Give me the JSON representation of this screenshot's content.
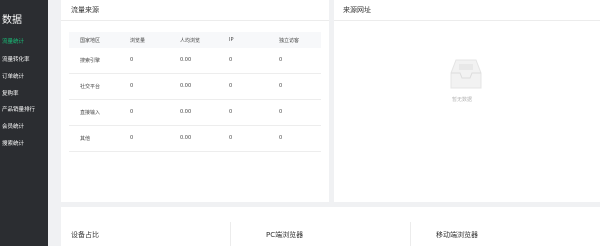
{
  "sidebar": {
    "title": "数据",
    "items": [
      {
        "label": "流量统计",
        "active": true
      },
      {
        "label": "流量转化率",
        "active": false
      },
      {
        "label": "订单统计",
        "active": false
      },
      {
        "label": "复购率",
        "active": false
      },
      {
        "label": "产品销量排行",
        "active": false
      },
      {
        "label": "会员统计",
        "active": false
      },
      {
        "label": "搜索统计",
        "active": false
      }
    ],
    "active_color": "#18c27a"
  },
  "traffic_source": {
    "title": "流量来源",
    "columns": [
      "国家地区",
      "浏览量",
      "人均浏览",
      "IP",
      "独立访客"
    ],
    "rows": [
      [
        "搜索引擎",
        "0",
        "0.00",
        "0",
        "0"
      ],
      [
        "社交平台",
        "0",
        "0.00",
        "0",
        "0"
      ],
      [
        "直接输入",
        "0",
        "0.00",
        "0",
        "0"
      ],
      [
        "其他",
        "0",
        "0.00",
        "0",
        "0"
      ]
    ]
  },
  "source_url": {
    "title": "来源网址",
    "empty_text": "暂无数据",
    "empty_icon": "inbox-icon"
  },
  "bottom": {
    "device_title": "设备占比",
    "pc_title": "PC端浏览器",
    "mobile_title": "移动端浏览器"
  }
}
